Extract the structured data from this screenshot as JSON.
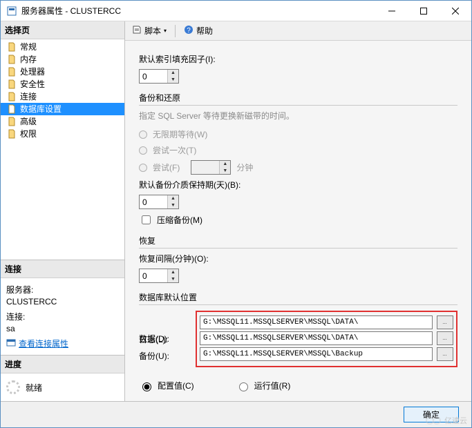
{
  "window": {
    "title": "服务器属性 - CLUSTERCC"
  },
  "left": {
    "header_select_page": "选择页",
    "tree": [
      {
        "label": "常规"
      },
      {
        "label": "内存"
      },
      {
        "label": "处理器"
      },
      {
        "label": "安全性"
      },
      {
        "label": "连接"
      },
      {
        "label": "数据库设置",
        "selected": true
      },
      {
        "label": "高级"
      },
      {
        "label": "权限"
      }
    ],
    "header_connection": "连接",
    "conn_server_label": "服务器:",
    "conn_server_value": "CLUSTERCC",
    "conn_login_label": "连接:",
    "conn_login_value": "sa",
    "view_conn_props": "查看连接属性",
    "header_progress": "进度",
    "progress_status": "就绪"
  },
  "toolbar": {
    "script": "脚本",
    "help": "帮助"
  },
  "form": {
    "fill_factor_label": "默认索引填充因子(I):",
    "fill_factor_value": "0",
    "section_backup_restore": "备份和还原",
    "backup_note": "指定 SQL Server 等待更换新磁带的时间。",
    "wait_indef": "无限期等待(W)",
    "try_once": "尝试一次(T)",
    "try_for": "尝试(F)",
    "try_for_unit": "分钟",
    "media_retention_label": "默认备份介质保持期(天)(B):",
    "media_retention_value": "0",
    "compress_backup": "压缩备份(M)",
    "section_recovery": "恢复",
    "recovery_interval_label": "恢复间隔(分钟)(O):",
    "recovery_interval_value": "0",
    "section_db_default_loc": "数据库默认位置",
    "data_label": "数据(D):",
    "data_value": "G:\\MSSQL11.MSSQLSERVER\\MSSQL\\DATA\\",
    "log_label": "日志(L):",
    "log_value": "G:\\MSSQL11.MSSQLSERVER\\MSSQL\\DATA\\",
    "backup_label": "备份(U):",
    "backup_value": "G:\\MSSQL11.MSSQLSERVER\\MSSQL\\Backup",
    "configured_value": "配置值(C)",
    "running_value": "运行值(R)"
  },
  "footer": {
    "ok": "确定"
  },
  "watermark": "亿速云"
}
